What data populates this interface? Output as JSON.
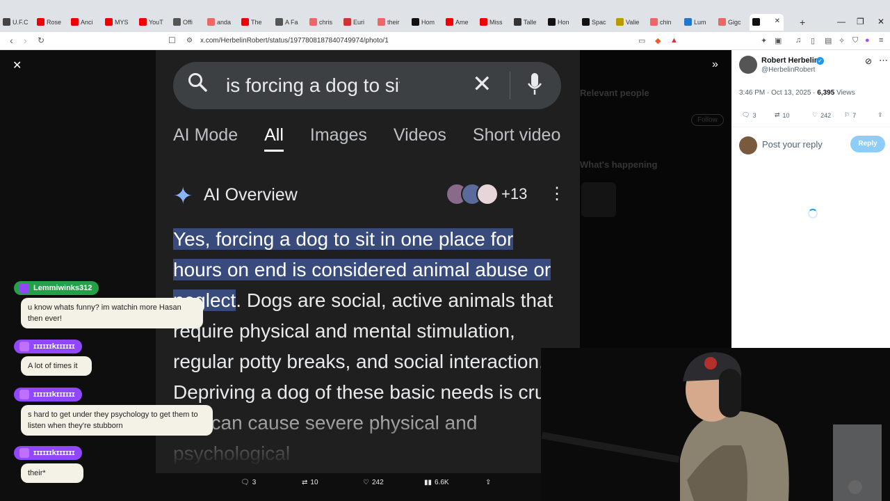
{
  "browser": {
    "tabs": [
      {
        "label": "U.F.C",
        "icon": "stack-icon",
        "color": "#444"
      },
      {
        "label": "Rose",
        "icon": "youtube-icon",
        "color": "#e00"
      },
      {
        "label": "Anci",
        "icon": "youtube-icon",
        "color": "#e00"
      },
      {
        "label": "MYS",
        "icon": "youtube-icon",
        "color": "#e00"
      },
      {
        "label": "YouT",
        "icon": "youtube-icon",
        "color": "#e00"
      },
      {
        "label": "Offi",
        "icon": "wikipedia-icon",
        "color": "#555"
      },
      {
        "label": "anda",
        "icon": "target-icon",
        "color": "#e66"
      },
      {
        "label": "The",
        "icon": "youtube-icon",
        "color": "#e00"
      },
      {
        "label": "A Fa",
        "icon": "wikipedia-icon",
        "color": "#555"
      },
      {
        "label": "chris",
        "icon": "target-icon",
        "color": "#e66"
      },
      {
        "label": "Euri",
        "icon": "cross-icon",
        "color": "#c33"
      },
      {
        "label": "their",
        "icon": "target-icon",
        "color": "#e66"
      },
      {
        "label": "Hom",
        "icon": "dot-icon",
        "color": "#111"
      },
      {
        "label": "Ame",
        "icon": "youtube-icon",
        "color": "#e00"
      },
      {
        "label": "Miss",
        "icon": "youtube-icon",
        "color": "#e00"
      },
      {
        "label": "Talle",
        "icon": "globe-icon",
        "color": "#333"
      },
      {
        "label": "Hon",
        "icon": "x-icon",
        "color": "#111"
      },
      {
        "label": "Spac",
        "icon": "x-icon",
        "color": "#111"
      },
      {
        "label": "Valie",
        "icon": "shield-icon",
        "color": "#b90"
      },
      {
        "label": "chin",
        "icon": "target-icon",
        "color": "#e66"
      },
      {
        "label": "Lum",
        "icon": "arrow-icon",
        "color": "#27c"
      },
      {
        "label": "Gigc",
        "icon": "target-icon",
        "color": "#e66"
      },
      {
        "label": "",
        "icon": "x-icon",
        "color": "#111",
        "active": true
      }
    ],
    "url": "x.com/HerbelinRobert/status/1977808187840749974/photo/1"
  },
  "screenshot": {
    "search_query": "is forcing a dog to sit in o",
    "tabs": [
      "AI Mode",
      "All",
      "Images",
      "Videos",
      "Short video"
    ],
    "active_tab": "All",
    "overview_title": "AI Overview",
    "source_count": "+13",
    "answer_highlight": "Yes, forcing a dog to sit in one place for hours on end is considered animal abuse or neglect",
    "answer_rest": ". Dogs are social, active animals that require physical and mental stimulation, regular potty breaks, and social interaction. Depriving a dog of these basic needs is cruel and can cause severe physical and psychological"
  },
  "photo_actions": {
    "replies": "3",
    "reposts": "10",
    "likes": "242",
    "views": "6.6K"
  },
  "post": {
    "author": "Robert Herbelin",
    "handle": "@HerbelinRobert",
    "time": "3:46 PM · Oct 13, 2025 · ",
    "views": "6,395",
    "views_label": " Views",
    "replies": "3",
    "reposts": "10",
    "likes": "242",
    "bookmarks": "7",
    "reply_placeholder": "Post your reply",
    "reply_button": "Reply"
  },
  "background_sidebar": {
    "relevant": "Relevant people",
    "happening": "What's happening",
    "follow": "Follow"
  },
  "chat": [
    {
      "user": "Lemmiwinks312",
      "color": "#24a148",
      "badge_color": "#9146ff",
      "message": "u know whats funny? im watchin more Hasan then ever!"
    },
    {
      "user": "ɪɪɪɪɪɪkɪɪɪɪɪɪ",
      "color": "#9146ff",
      "badge_color": "#c070ff",
      "message": "A lot of times it"
    },
    {
      "user": "ɪɪɪɪɪɪkɪɪɪɪɪɪ",
      "color": "#9146ff",
      "badge_color": "#c070ff",
      "message": "s hard to get under they psychology to get them to listen when they're stubborn"
    },
    {
      "user": "ɪɪɪɪɪɪkɪɪɪɪɪɪ",
      "color": "#9146ff",
      "badge_color": "#c070ff",
      "message": "their*"
    }
  ],
  "colors": {
    "accent": "#1d9bf0",
    "highlight": "#394a7c",
    "chat_bubble": "#f4f1e6"
  }
}
